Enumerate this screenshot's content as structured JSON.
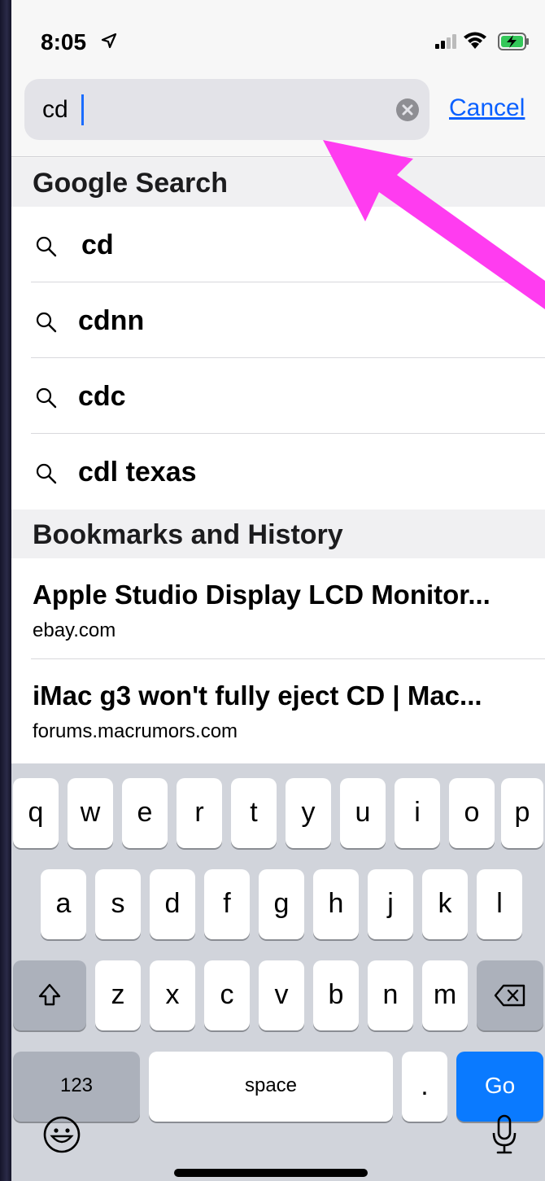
{
  "status_bar": {
    "time": "8:05"
  },
  "search": {
    "query": "cd",
    "cancel_label": "Cancel"
  },
  "google_section": {
    "header": "Google Search",
    "suggestions": [
      "cd",
      "cdnn",
      "cdc",
      "cdl texas"
    ]
  },
  "history_section": {
    "header": "Bookmarks and History",
    "items": [
      {
        "title": "Apple Studio Display LCD Monitor...",
        "url": "ebay.com"
      },
      {
        "title": "iMac g3 won't fully eject CD | Mac...",
        "url": "forums.macrumors.com"
      }
    ]
  },
  "keyboard": {
    "row1": [
      "q",
      "w",
      "e",
      "r",
      "t",
      "y",
      "u",
      "i",
      "o",
      "p"
    ],
    "row2": [
      "a",
      "s",
      "d",
      "f",
      "g",
      "h",
      "j",
      "k",
      "l"
    ],
    "row3": [
      "z",
      "x",
      "c",
      "v",
      "b",
      "n",
      "m"
    ],
    "numbers_label": "123",
    "space_label": "space",
    "period_label": ".",
    "go_label": "Go"
  },
  "colors": {
    "accent": "#0a60ff",
    "annotation_arrow": "#ff3cf0"
  },
  "icons": [
    "location-arrow-icon",
    "signal-icon",
    "wifi-icon",
    "battery-charging-icon",
    "clear-icon",
    "magnifier-icon",
    "shift-icon",
    "backspace-icon",
    "emoji-icon",
    "microphone-icon"
  ]
}
